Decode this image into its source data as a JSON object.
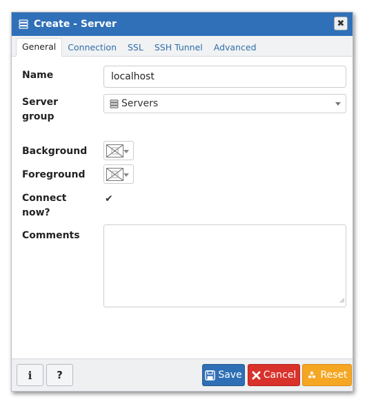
{
  "dialog": {
    "title": "Create - Server",
    "close_symbol": "✖"
  },
  "tabs": [
    {
      "label": "General",
      "active": true
    },
    {
      "label": "Connection",
      "active": false
    },
    {
      "label": "SSL",
      "active": false
    },
    {
      "label": "SSH Tunnel",
      "active": false
    },
    {
      "label": "Advanced",
      "active": false
    }
  ],
  "form": {
    "name": {
      "label": "Name",
      "value": "localhost"
    },
    "server_group": {
      "label_line1": "Server",
      "label_line2": "group",
      "value": "Servers"
    },
    "background": {
      "label": "Background"
    },
    "foreground": {
      "label": "Foreground"
    },
    "connect_now": {
      "label_line1": "Connect",
      "label_line2": "now?",
      "checked": true,
      "check_symbol": "✔"
    },
    "comments": {
      "label": "Comments",
      "value": ""
    }
  },
  "footer": {
    "info_symbol": "i",
    "help_symbol": "?",
    "save_label": "Save",
    "cancel_label": "Cancel",
    "reset_label": "Reset"
  },
  "colors": {
    "titlebar": "#2f70b8",
    "save": "#2f6fb5",
    "cancel": "#d9312b",
    "reset": "#f5a623",
    "tab_link": "#2f6ea6"
  }
}
